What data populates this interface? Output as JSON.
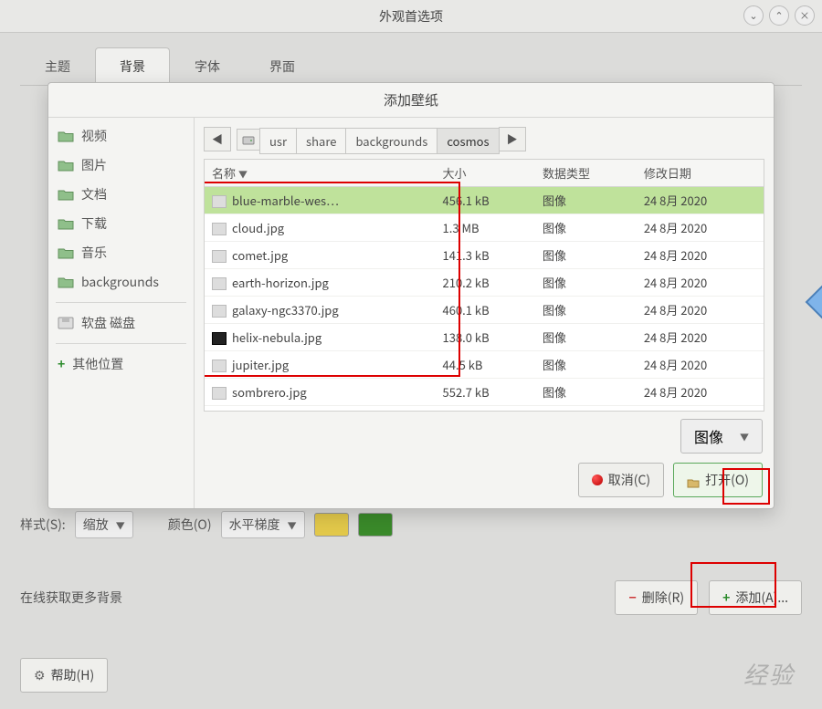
{
  "window": {
    "title": "外观首选项"
  },
  "tabs": [
    "主题",
    "背景",
    "字体",
    "界面"
  ],
  "active_tab": 1,
  "style_label": "样式(S):",
  "style_value": "缩放",
  "color_label": "颜色(O)",
  "gradient_value": "水平梯度",
  "swatch1": "#e2c84a",
  "swatch2": "#3a8a2a",
  "online_label": "在线获取更多背景",
  "remove_label": "删除(R)",
  "add_label": "添加(A)...",
  "help_label": "帮助(H)",
  "dialog": {
    "title": "添加壁纸",
    "sidebar": [
      {
        "label": "视频",
        "icon": "folder"
      },
      {
        "label": "图片",
        "icon": "folder"
      },
      {
        "label": "文档",
        "icon": "folder"
      },
      {
        "label": "下载",
        "icon": "folder"
      },
      {
        "label": "音乐",
        "icon": "folder"
      },
      {
        "label": "backgrounds",
        "icon": "folder"
      },
      {
        "sep": true
      },
      {
        "label": "软盘 磁盘",
        "icon": "disk"
      },
      {
        "sep": true
      },
      {
        "label": "其他位置",
        "icon": "plus"
      }
    ],
    "breadcrumb": [
      "usr",
      "share",
      "backgrounds",
      "cosmos"
    ],
    "breadcrumb_active": 3,
    "columns": {
      "name": "名称",
      "size": "大小",
      "type": "数据类型",
      "date": "修改日期"
    },
    "files": [
      {
        "name": "blue-marble-wes…",
        "size": "456.1 kB",
        "type": "图像",
        "date": "24 8月 2020",
        "selected": true
      },
      {
        "name": "cloud.jpg",
        "size": "1.3 MB",
        "type": "图像",
        "date": "24 8月 2020"
      },
      {
        "name": "comet.jpg",
        "size": "141.3 kB",
        "type": "图像",
        "date": "24 8月 2020"
      },
      {
        "name": "earth-horizon.jpg",
        "size": "210.2 kB",
        "type": "图像",
        "date": "24 8月 2020"
      },
      {
        "name": "galaxy-ngc3370.jpg",
        "size": "460.1 kB",
        "type": "图像",
        "date": "24 8月 2020"
      },
      {
        "name": "helix-nebula.jpg",
        "size": "138.0 kB",
        "type": "图像",
        "date": "24 8月 2020",
        "dark": true
      },
      {
        "name": "jupiter.jpg",
        "size": "44.5 kB",
        "type": "图像",
        "date": "24 8月 2020"
      },
      {
        "name": "sombrero.jpg",
        "size": "552.7 kB",
        "type": "图像",
        "date": "24 8月 2020"
      }
    ],
    "filter_value": "图像",
    "cancel_label": "取消(C)",
    "open_label": "打开(O)"
  },
  "watermark": "经验"
}
